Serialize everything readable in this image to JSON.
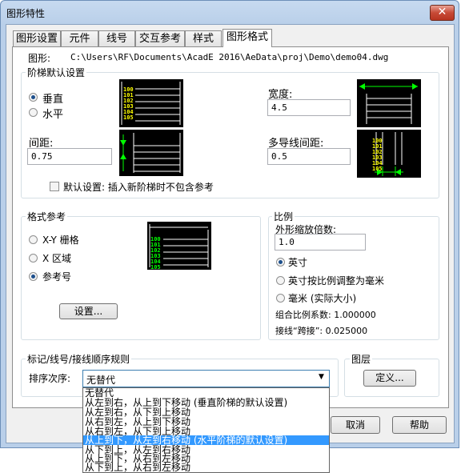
{
  "window": {
    "title": "图形特性",
    "close_glyph": "✕"
  },
  "tabs": [
    {
      "label": "图形设置"
    },
    {
      "label": "元件"
    },
    {
      "label": "线号"
    },
    {
      "label": "交互参考"
    },
    {
      "label": "样式"
    },
    {
      "label": "图形格式",
      "active": true
    }
  ],
  "drawing": {
    "label": "图形:",
    "path": "C:\\Users\\RF\\Documents\\AcadE 2016\\AeData\\proj\\Demo\\demo04.dwg"
  },
  "ladder": {
    "group_label": "阶梯默认设置",
    "orientation_options": [
      {
        "label": "垂直",
        "selected": true
      },
      {
        "label": "水平",
        "selected": false
      }
    ],
    "width_label": "宽度:",
    "width_value": "4.5",
    "spacing_label": "间距:",
    "spacing_value": "0.75",
    "multiwire_label": "多导线间距:",
    "multiwire_value": "0.5",
    "default_checkbox_label": "默认设置: 插入新阶梯时不包含参考",
    "default_checked": false,
    "preview_numbers": [
      "100",
      "101",
      "102",
      "103",
      "104",
      "105"
    ]
  },
  "format_ref": {
    "group_label": "格式参考",
    "options": [
      {
        "label": "X-Y 栅格",
        "selected": false
      },
      {
        "label": "X 区域",
        "selected": false
      },
      {
        "label": "参考号",
        "selected": true
      }
    ],
    "settings_button": "设置..."
  },
  "scale": {
    "group_label": "比例",
    "feature_label": "外形缩放倍数:",
    "feature_value": "1.0",
    "units": [
      {
        "label": "英寸",
        "selected": true
      },
      {
        "label": "英寸按比例调整为毫米",
        "selected": false
      },
      {
        "label": "毫米 (实际大小)",
        "selected": false
      }
    ],
    "combined_label": "组合比例系数: 1.000000",
    "jumper_label": "接线“跨接”: 0.025000"
  },
  "tag_sort": {
    "group_label": "标记/线号/接线顺序规则",
    "sort_label": "排序次序:",
    "sort_value": "无替代",
    "options": [
      "无替代",
      "从左到右，从上到下移动 (垂直阶梯的默认设置)",
      "从左到右，从下到上移动",
      "从右到左，从上到下移动",
      "从右到左，从下到上移动",
      "从上到下，从左到右移动 (水平阶梯的默认设置)",
      "从下到上，从左到右移动",
      "从上到下，从右到左移动",
      "从下到上，从右到左移动"
    ],
    "highlighted_index": 5
  },
  "layers": {
    "group_label": "图层",
    "define_button": "定义..."
  },
  "buttons": {
    "cancel": "取消",
    "help": "帮助"
  },
  "colors": {
    "title_bar": "#b9cfe9",
    "preview_bg": "#000000",
    "preview_lines": "#ffffff",
    "preview_numbers": "#ffff00",
    "preview_arrows": "#00ff00",
    "selection": "#3399ff"
  }
}
